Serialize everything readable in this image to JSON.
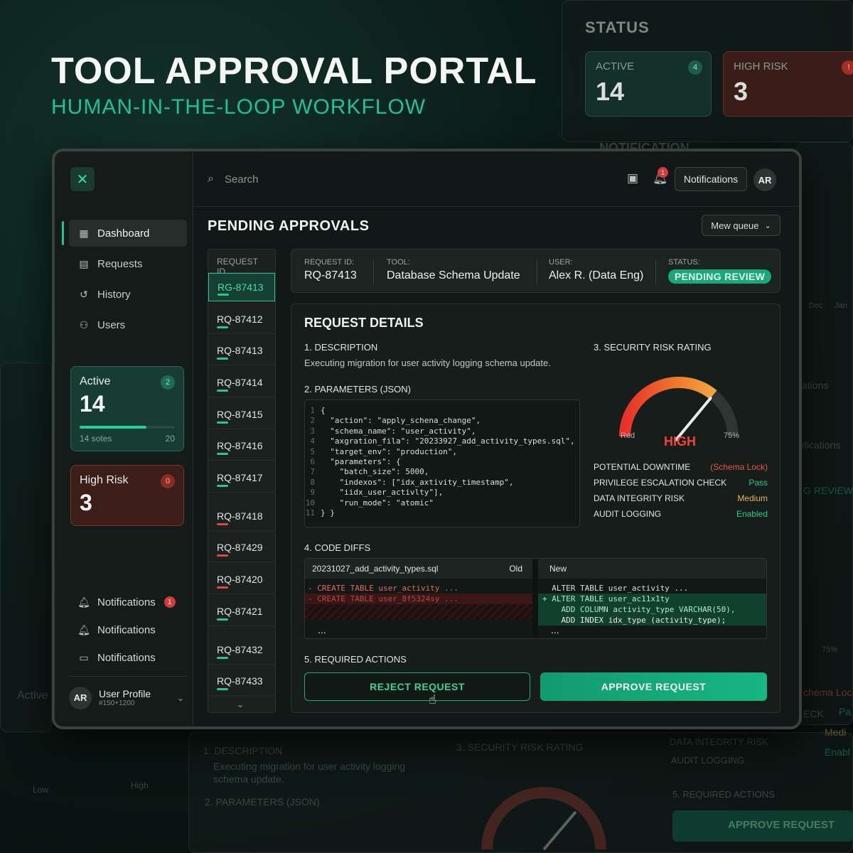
{
  "hero": {
    "title": "TOOL APPROVAL PORTAL",
    "subtitle": "HUMAN-IN-THE-LOOP WORKFLOW"
  },
  "status_panel": {
    "heading": "STATUS",
    "active": {
      "label": "ACTIVE",
      "value": "14",
      "badge": "4"
    },
    "high_risk": {
      "label": "HIGH RISK",
      "value": "3",
      "badge": "!"
    },
    "notification_heading": "NOTIFICATION"
  },
  "sidebar": {
    "nav": [
      {
        "label": "Dashboard",
        "icon": "grid-icon"
      },
      {
        "label": "Requests",
        "icon": "document-icon"
      },
      {
        "label": "History",
        "icon": "history-icon"
      },
      {
        "label": "Users",
        "icon": "users-icon"
      }
    ],
    "active_card": {
      "label": "Active",
      "value": "14",
      "badge": "2",
      "foot_left": "14 sotes",
      "foot_right": "20",
      "progress": 0.7
    },
    "risk_card": {
      "label": "High Risk",
      "value": "3",
      "badge": "0"
    },
    "notifications": [
      {
        "label": "Notifications",
        "badge": "1"
      },
      {
        "label": "Notifications"
      },
      {
        "label": "Notifications"
      }
    ],
    "profile": {
      "initials": "AR",
      "name": "User Profile",
      "sub": "#150+1200"
    }
  },
  "topbar": {
    "search_placeholder": "Search",
    "notif_badge": "1",
    "notifications_button": "Notifications",
    "avatar": "AR"
  },
  "main": {
    "title": "PENDING APPROVALS",
    "queue_button": "Mew queue",
    "request_list": {
      "header": "REQUEST ID",
      "items": [
        {
          "id": "RG-87413",
          "bar": "green",
          "selected": true
        },
        {
          "id": "RQ-87412",
          "bar": "green"
        },
        {
          "id": "RQ-87413",
          "bar": "green"
        },
        {
          "id": "RQ-87414",
          "bar": "green"
        },
        {
          "id": "RQ-87415",
          "bar": "green"
        },
        {
          "id": "RQ-87416",
          "bar": "green"
        },
        {
          "id": "RQ-87417",
          "bar": "green"
        },
        {
          "id": "RQ-87418",
          "bar": "red"
        },
        {
          "id": "RQ-87429",
          "bar": "red"
        },
        {
          "id": "RQ-87420",
          "bar": "red"
        },
        {
          "id": "RQ-87421",
          "bar": "green"
        },
        {
          "id": "RQ-87432",
          "bar": "green"
        },
        {
          "id": "RQ-87433",
          "bar": "green"
        }
      ]
    },
    "request_header": {
      "id_label": "REQUEST ID:",
      "id_value": "RQ-87413",
      "tool_label": "TOOL:",
      "tool_value": "Database Schema Update",
      "user_label": "USER:",
      "user_value": "Alex R. (Data Eng)",
      "status_label": "STATUS:",
      "status_value": "PENDING REVIEW"
    },
    "details": {
      "title": "REQUEST DETAILS",
      "description_heading": "1. DESCRIPTION",
      "description": "Executing migration for user activity logging schema update.",
      "params_heading": "2. PARAMETERS (JSON)",
      "json_lines": [
        "{",
        "  \"action\": \"apply_schena_change\",",
        "  \"schema_name\": \"user_activity\",",
        "  \"axgration_fila\": \"20233927_add_activity_types.sql\",",
        "  \"target_env\": \"production\",",
        "  \"parameters\": {",
        "    \"batch_size\": 5000,",
        "    \"indexos\": [\"idx_axtivity_timestamp\",",
        "    \"iidx_user_activlty\"],",
        "    \"run_mode\": \"atomic\"",
        "} }"
      ],
      "risk_heading": "3. SECURITY RISK RATING",
      "gauge": {
        "level": 0.72,
        "left_label": "Red",
        "right_label": "75%",
        "rating": "HIGH"
      },
      "risk_rows": [
        {
          "label": "POTENTIAL DOWNTIME",
          "value": "(Schema Lock)",
          "color": "#e8584a"
        },
        {
          "label": "PRIVILEGE ESCALATION CHECK",
          "value": "Pass",
          "color": "#27c98f"
        },
        {
          "label": "DATA INTEGRITY RISK",
          "value": "Medium",
          "color": "#e0b84a"
        },
        {
          "label": "AUDIT LOGGING",
          "value": "Enabled",
          "color": "#27c98f"
        }
      ],
      "diffs_heading": "4. CODE DIFFS",
      "diff": {
        "file": "20231027_add_activity_types.sql",
        "old_label": "Old",
        "new_label": "New",
        "old_lines": [
          "- CREATE TABLE user_activity ...",
          "- CREATE TABLE user_8f5324sy ..."
        ],
        "new_lines": [
          "  ALTER TABLE user_activity ...",
          "+ ALTER TABLE user_ac11x1ty",
          "    ADD COLUMN activity_type VARCHAR(50),",
          "    ADD INDEX idx_type (activity_type);"
        ],
        "ellipsis": "..."
      },
      "actions_heading": "5. REQUIRED ACTIONS",
      "reject_label": "REJECT REQUEST",
      "approve_label": "APPROVE REQUEST"
    }
  },
  "colors": {
    "accent": "#1fc48d",
    "danger": "#e8453a",
    "bg": "#121817"
  },
  "background_ghost": {
    "desc_heading": "1. DESCRIPTION",
    "desc_text": "Executing migration for user activity logging",
    "desc_text2": "schema update.",
    "params_heading": "2. PARAMETERS (JSON)",
    "risk_heading": "3. SECURITY RISK RATING",
    "integrity": "DATA INTEGRITY RISK",
    "audit": "AUDIT LOGGING",
    "actions_heading": "5. REQUIRED ACTIONS",
    "approve": "APPROVE REQUEST",
    "low": "Low",
    "high": "High",
    "active": "Active",
    "review": "G REVIEW",
    "notifications": "ifications",
    "ations": "ations",
    "dec": "Dec",
    "jan": "Jan",
    "schema_lock": "chema Loc",
    "eck": "ECK",
    "pa": "Pa",
    "medi": "Medi",
    "enabl": "Enabl",
    "pct": "75%"
  }
}
